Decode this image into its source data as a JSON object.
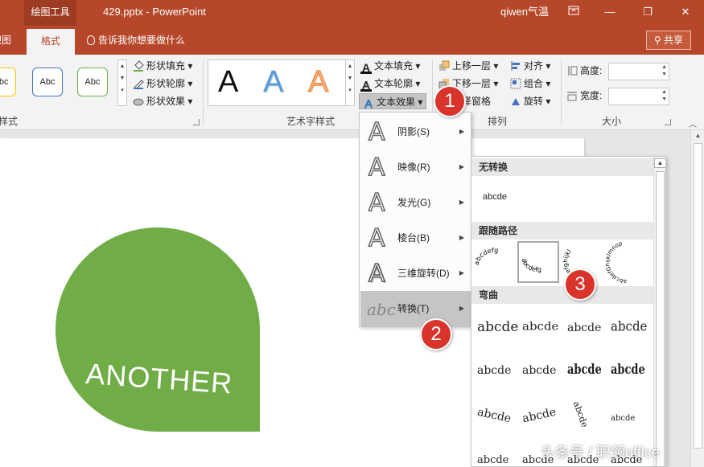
{
  "titlebar": {
    "tools_tab": "绘图工具",
    "file_name": "429.pptx - PowerPoint",
    "user": "qiwen气温",
    "restore_icon": "ribbon-display-icon",
    "minimize": "—",
    "maximize": "❐",
    "close": "✕"
  },
  "tabs": {
    "view": "视图",
    "format": "格式",
    "tell_me": "告诉我你想要做什么",
    "share": "共享"
  },
  "ribbon": {
    "shape_styles": {
      "samples": [
        "Abc",
        "Abc",
        "Abc"
      ],
      "fill": "形状填充",
      "outline": "形状轮廓",
      "effects": "形状效果",
      "group_label": "样式"
    },
    "wordart": {
      "samples": [
        "A",
        "A",
        "A"
      ],
      "text_fill": "文本填充",
      "text_outline": "文本轮廓",
      "text_effects": "文本效果",
      "group_label": "艺术字样式"
    },
    "arrange": {
      "bring_forward": "上移一层",
      "send_backward": "下移一层",
      "selection_pane": "选择窗格",
      "align": "对齐",
      "group": "组合",
      "rotate": "旋转",
      "group_label": "排列"
    },
    "size": {
      "height_label": "高度:",
      "width_label": "宽度:",
      "height_value": "",
      "width_value": "",
      "group_label": "大小"
    }
  },
  "slide": {
    "shape_text": "ANOTHER",
    "shape_color": "#70ad47"
  },
  "effects_menu": {
    "items": [
      {
        "label": "阴影(S)",
        "icon": "shadow-a-icon"
      },
      {
        "label": "映像(R)",
        "icon": "reflection-a-icon"
      },
      {
        "label": "发光(G)",
        "icon": "glow-a-icon"
      },
      {
        "label": "棱台(B)",
        "icon": "bevel-a-icon"
      },
      {
        "label": "三维旋转(D)",
        "icon": "3d-rotation-a-icon"
      },
      {
        "label": "转换(T)",
        "icon": "abc-transform-icon"
      }
    ],
    "selected": "转换(T)"
  },
  "transform_gallery": {
    "no_transform": "无转换",
    "no_transform_sample": "abcde",
    "follow_path": "跟随路径",
    "follow_path_samples": [
      "abcdefg",
      "abcdefg",
      "abcdefghijkl",
      "abcdefGhijklmnop"
    ],
    "warp": "弯曲",
    "warp_samples": [
      "abcde",
      "abcde",
      "abcde",
      "abcde",
      "abcde",
      "abcde",
      "abcde",
      "abcde",
      "abcde",
      "abcde",
      "abcde",
      "abcde",
      "abcde",
      "abcde",
      "abcde",
      "abcde"
    ]
  },
  "badges": [
    "1",
    "2",
    "3"
  ],
  "watermark": "头条号 / 职领office",
  "colors": {
    "accent": "#b7472a",
    "badge": "#d9342b"
  }
}
